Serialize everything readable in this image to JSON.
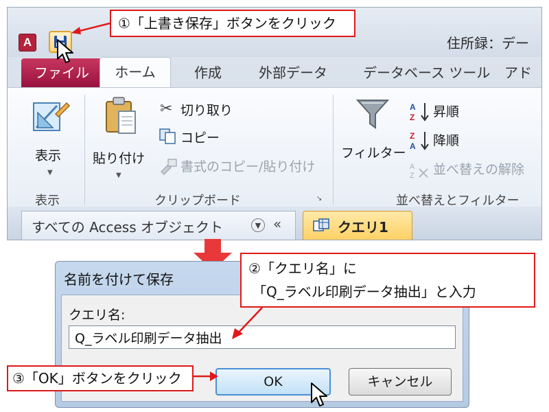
{
  "access_window": {
    "doc_title": "住所録：デー",
    "tabs": {
      "file": "ファイル",
      "home": "ホーム",
      "create": "作成",
      "external": "外部データ",
      "dbtools": "データベース ツール",
      "addin": "アド"
    },
    "ribbon": {
      "view": {
        "label": "表示",
        "group": "表示"
      },
      "clipboard": {
        "paste": "貼り付け",
        "cut": "切り取り",
        "copy": "コピー",
        "format_painter": "書式のコピー/貼り付け",
        "group": "クリップボード"
      },
      "sort_filter": {
        "filter": "フィルター",
        "ascending": "昇順",
        "descending": "降順",
        "clear_sort": "並べ替えの解除",
        "group": "並べ替えとフィルター"
      }
    },
    "nav_pane": {
      "title": "すべての Access オブジェクト",
      "collapse": "«"
    },
    "object_tab": {
      "label": "クエリ1"
    }
  },
  "callouts": {
    "step1": "①「上書き保存」ボタンをクリック",
    "step2_line1": "②「クエリ名」に",
    "step2_line2": "「Q_ラベル印刷データ抽出」と入力",
    "step3": "③「OK」ボタンをクリック"
  },
  "dialog": {
    "title": "名前を付けて保存",
    "field_label": "クエリ名:",
    "field_value": "Q_ラベル印刷データ抽出",
    "ok": "OK",
    "cancel": "キャンセル"
  },
  "colors": {
    "callout_border": "#e01818",
    "file_tab": "#b0204a",
    "arrow": "#e8383a",
    "dialog_frame": "#bcd0e8"
  }
}
